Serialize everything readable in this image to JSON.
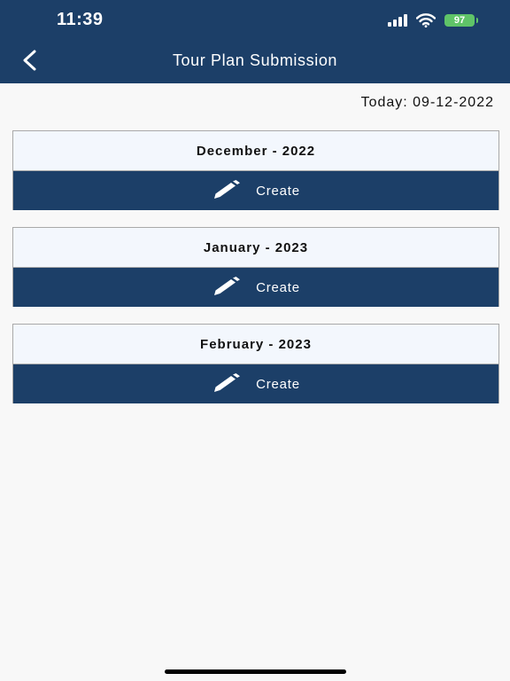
{
  "status": {
    "time": "11:39",
    "battery": "97"
  },
  "header": {
    "title": "Tour Plan Submission"
  },
  "today": "Today: 09-12-2022",
  "months": [
    {
      "label": "December - 2022",
      "button": "Create"
    },
    {
      "label": "January - 2023",
      "button": "Create"
    },
    {
      "label": "February - 2023",
      "button": "Create"
    }
  ],
  "colors": {
    "primary": "#1c3f68",
    "card_title_bg": "#f3f7fd",
    "battery": "#5fc468"
  },
  "icons": {
    "back": "chevron-left-icon",
    "edit": "pencil-icon"
  }
}
